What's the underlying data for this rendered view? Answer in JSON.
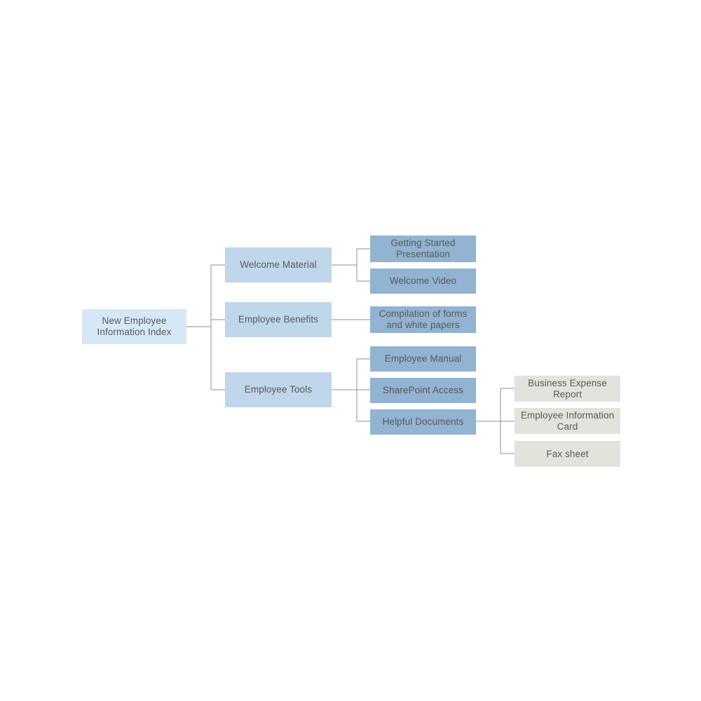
{
  "diagram": {
    "title": "New Employee Information Index",
    "type": "tree-hierarchy",
    "colors": {
      "root_fill": "#d6e8f5",
      "level2_fill": "#c0d6ea",
      "level3_fill": "#92b3d1",
      "level4_fill": "#e1e4db",
      "connector": "#8d8f91",
      "text": "#58595b",
      "background": "#ffffff"
    },
    "nodes": {
      "root": {
        "label": "New Employee Information Index",
        "level": 1
      },
      "level2": [
        {
          "id": "welcome-material",
          "label": "Welcome Material"
        },
        {
          "id": "employee-benefits",
          "label": "Employee Benefits"
        },
        {
          "id": "employee-tools",
          "label": "Employee Tools"
        }
      ],
      "level3": [
        {
          "id": "getting-started-presentation",
          "label": "Getting Started Presentation",
          "parent": "welcome-material"
        },
        {
          "id": "welcome-video",
          "label": "Welcome Video",
          "parent": "welcome-material"
        },
        {
          "id": "compilation-of-forms",
          "label": "Compilation of forms and white papers",
          "parent": "employee-benefits"
        },
        {
          "id": "employee-manual",
          "label": "Employee Manual",
          "parent": "employee-tools"
        },
        {
          "id": "sharepoint-access",
          "label": "SharePoint Access",
          "parent": "employee-tools"
        },
        {
          "id": "helpful-documents",
          "label": "Helpful Documents",
          "parent": "employee-tools"
        }
      ],
      "level4": [
        {
          "id": "business-expense-report",
          "label": "Business Expense Report",
          "parent": "helpful-documents"
        },
        {
          "id": "employee-information-card",
          "label": "Employee Information Card",
          "parent": "helpful-documents"
        },
        {
          "id": "fax-sheet",
          "label": "Fax sheet",
          "parent": "helpful-documents"
        }
      ]
    }
  }
}
